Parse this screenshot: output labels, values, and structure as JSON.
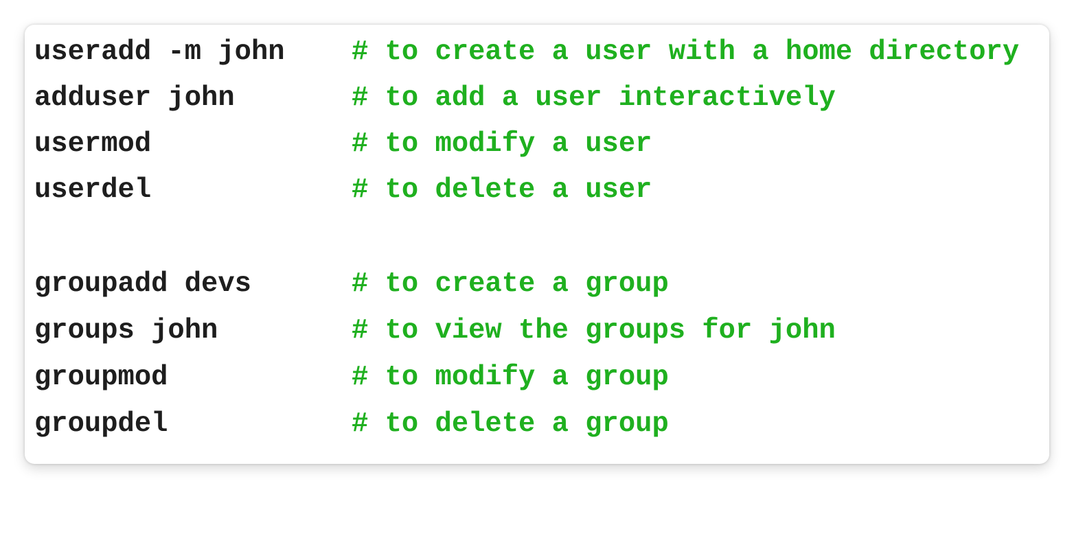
{
  "colors": {
    "command": "#1e1e1e",
    "comment": "#1fb01f",
    "background": "#ffffff"
  },
  "code_block": {
    "lines": [
      {
        "command": "useradd -m john",
        "comment": "# to create a user with a home directory"
      },
      {
        "command": "adduser john",
        "comment": "# to add a user interactively"
      },
      {
        "command": "usermod",
        "comment": "# to modify a user"
      },
      {
        "command": "userdel",
        "comment": "# to delete a user"
      },
      {
        "command": "",
        "comment": ""
      },
      {
        "command": "groupadd devs",
        "comment": "# to create a group"
      },
      {
        "command": "groups john",
        "comment": "# to view the groups for john"
      },
      {
        "command": "groupmod",
        "comment": "# to modify a group"
      },
      {
        "command": "groupdel",
        "comment": "# to delete a group"
      }
    ]
  }
}
